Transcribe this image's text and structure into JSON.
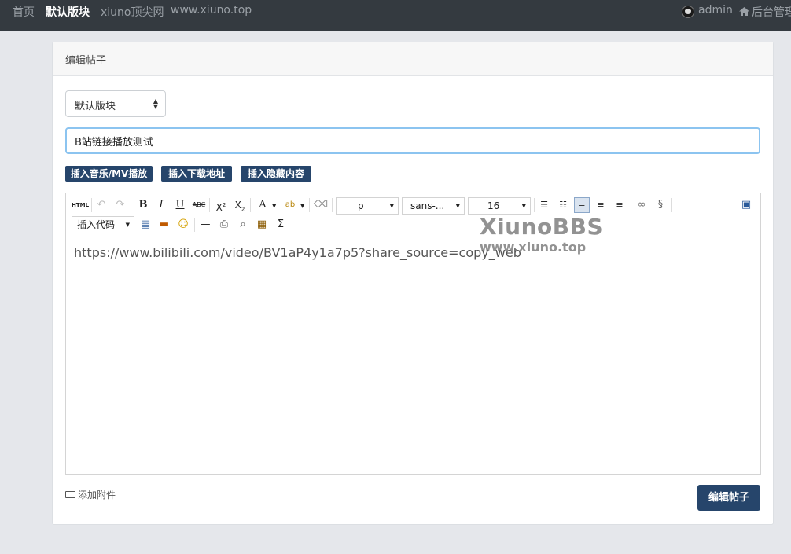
{
  "nav": {
    "home": "首页",
    "forum": "默认版块",
    "site": "xiuno顶尖网",
    "url": "www.xiuno.top",
    "user": "admin",
    "admin": "后台管理"
  },
  "card": {
    "title": "编辑帖子"
  },
  "form": {
    "forum_value": "默认版块",
    "subject_value": "B站链接播放测试",
    "btn_music": "插入音乐/MV播放",
    "btn_download": "插入下载地址",
    "btn_hidden": "插入隐藏内容",
    "attach_label": "添加附件",
    "submit_label": "编辑帖子"
  },
  "toolbar": {
    "html_label": "HTML",
    "format_value": "p",
    "font_value": "sans-...",
    "size_value": "16",
    "code_value": "插入代码"
  },
  "editor": {
    "content": "https://www.bilibili.com/video/BV1aP4y1a7p5?share_source=copy_web"
  },
  "watermark": {
    "name": "XiunoBBS",
    "url": "www.xiuno.top"
  },
  "colors": {
    "navbar": "#343a40",
    "primary": "#26456b",
    "focus": "#8cc4f0"
  }
}
